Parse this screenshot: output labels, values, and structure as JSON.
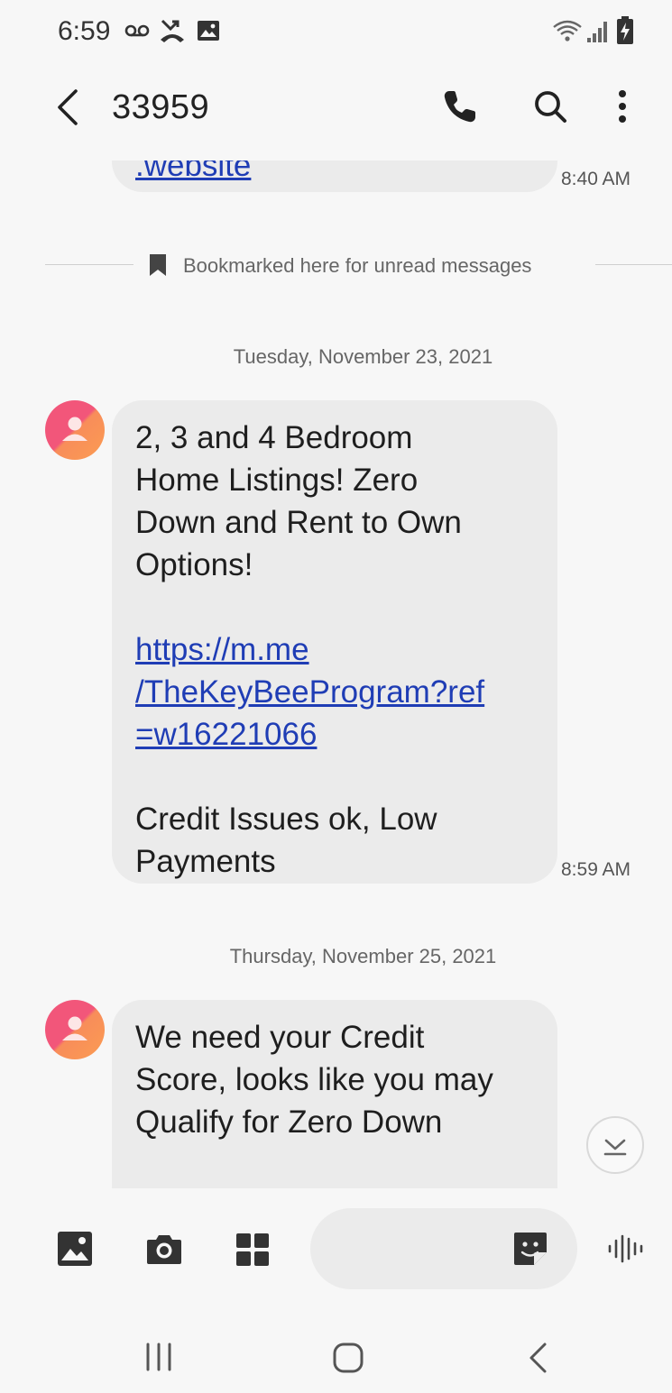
{
  "status_bar": {
    "time": "6:59",
    "icons": [
      "voicemail-icon",
      "missed-call-icon",
      "image-icon",
      "wifi-icon",
      "signal-icon",
      "battery-charging-icon"
    ]
  },
  "header": {
    "title": "33959",
    "icons": [
      "back-icon",
      "phone-icon",
      "search-icon",
      "more-options-icon"
    ]
  },
  "conversation": {
    "previous_fragment": {
      "link_text": ".website",
      "time": "8:40 AM"
    },
    "bookmark_label": "Bookmarked here for unread messages",
    "groups": [
      {
        "date": "Tuesday, November 23, 2021",
        "message": {
          "text_1": "2, 3 and 4 Bedroom\nHome Listings! Zero\nDown and Rent to Own\nOptions!",
          "link": "https://m.me\n/TheKeyBeeProgram?ref\n=w16221066",
          "text_2": "Credit Issues ok, Low\nPayments",
          "time": "8:59 AM"
        }
      },
      {
        "date": "Thursday, November 25, 2021",
        "message": {
          "text_1": "We need your Credit\nScore, looks like you may\nQualify for Zero Down"
        }
      }
    ]
  },
  "composer": {
    "icons": [
      "gallery-icon",
      "camera-icon",
      "apps-grid-icon",
      "sticker-icon",
      "voice-record-icon"
    ],
    "placeholder": ""
  },
  "nav_bar": {
    "icons": [
      "recent-apps-icon",
      "home-icon",
      "back-nav-icon"
    ]
  }
}
